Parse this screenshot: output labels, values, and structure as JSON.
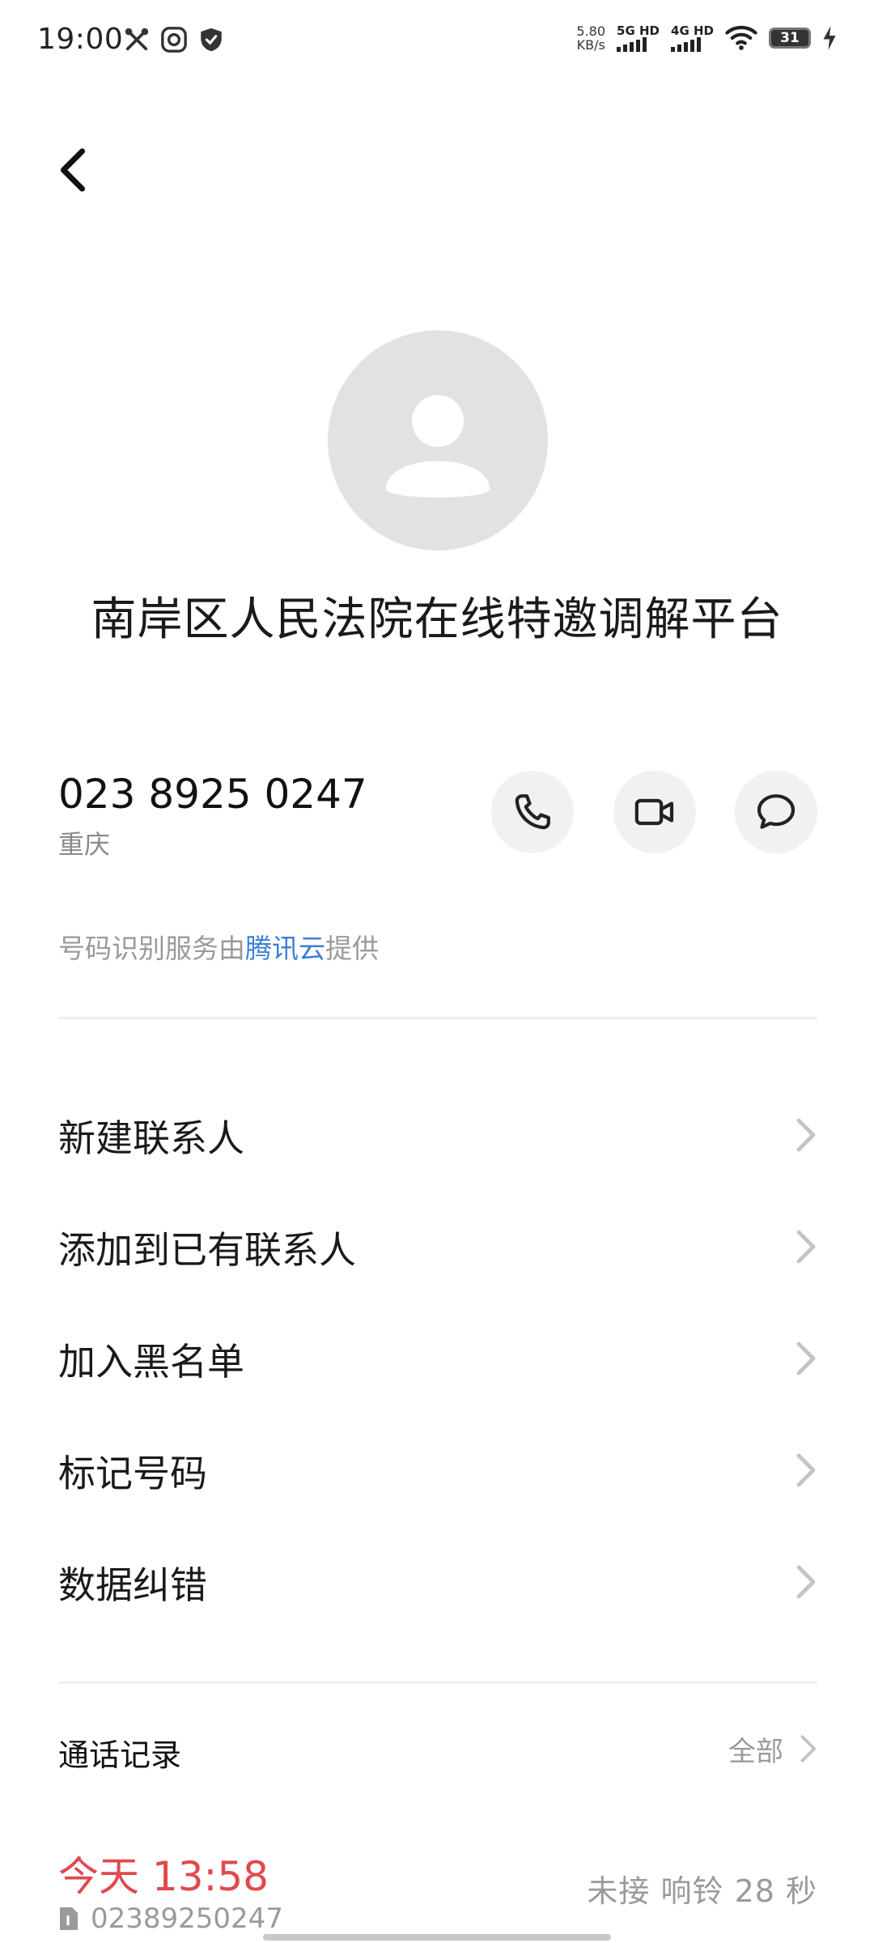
{
  "status_bar": {
    "time": "19:00",
    "net_speed_value": "5.80",
    "net_speed_unit": "KB/s",
    "sim1_label": "5G HD",
    "sim2_label": "4G HD",
    "battery": "31"
  },
  "contact": {
    "name": "南岸区人民法院在线特邀调解平台",
    "phone": "023 8925 0247",
    "location": "重庆"
  },
  "provider": {
    "prefix": "号码识别服务由",
    "link": "腾讯云",
    "suffix": "提供"
  },
  "menu": {
    "items": [
      {
        "label": "新建联系人"
      },
      {
        "label": "添加到已有联系人"
      },
      {
        "label": "加入黑名单"
      },
      {
        "label": "标记号码"
      },
      {
        "label": "数据纠错"
      }
    ]
  },
  "call_records": {
    "title": "通话记录",
    "all_label": "全部",
    "entries": [
      {
        "time": "今天 13:58",
        "number": "02389250247",
        "status": "未接 响铃 28 秒"
      }
    ]
  },
  "colors": {
    "accent_link": "#3b7fd4",
    "missed_call": "#e0494d"
  }
}
